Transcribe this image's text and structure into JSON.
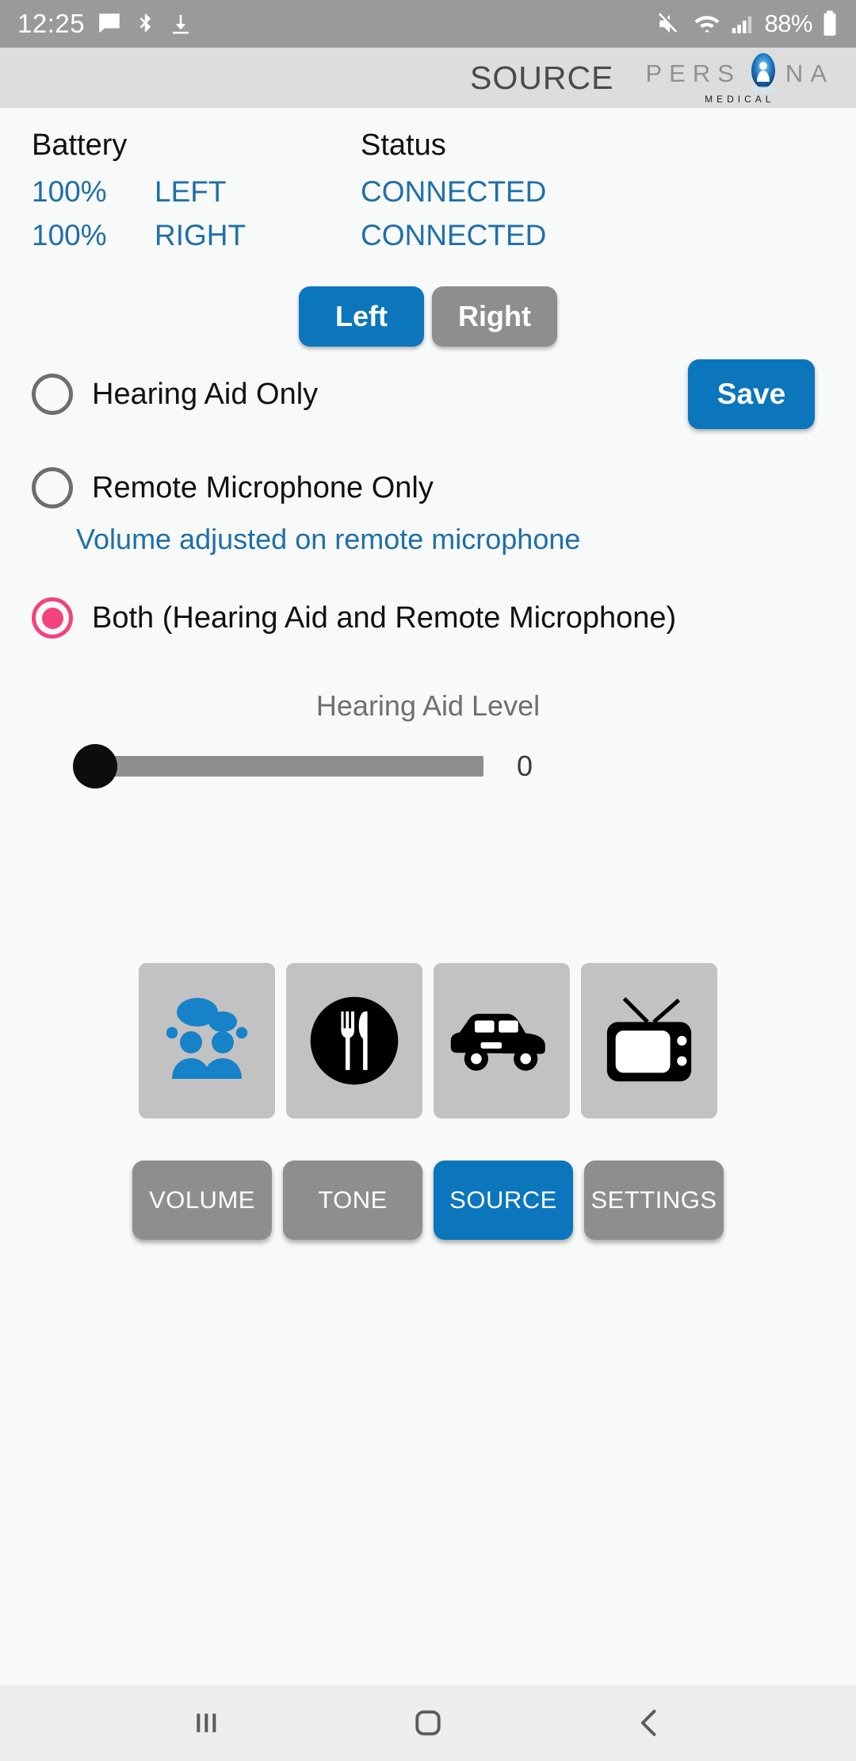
{
  "status_bar": {
    "time": "12:25",
    "battery_text": "88%",
    "icons": [
      "message-icon",
      "bluetooth-audio-icon",
      "download-icon",
      "mute-icon",
      "wifi-icon",
      "cellular-signal-icon",
      "battery-icon"
    ]
  },
  "app_bar": {
    "title": "SOURCE",
    "brand_letters": [
      "P",
      "E",
      "R",
      "S",
      "N",
      "A"
    ],
    "brand_mark": "persona-logo-icon",
    "brand_subtitle": "MEDICAL"
  },
  "info": {
    "battery_header": "Battery",
    "status_header": "Status",
    "rows": [
      {
        "percent": "100%",
        "side": "LEFT",
        "status": "CONNECTED"
      },
      {
        "percent": "100%",
        "side": "RIGHT",
        "status": "CONNECTED"
      }
    ]
  },
  "side_selector": {
    "left_label": "Left",
    "right_label": "Right",
    "selected": "Left",
    "selected_color": "#0b76bc",
    "unselected_color": "#8e8e8e"
  },
  "save": {
    "label": "Save",
    "color": "#0b76bc"
  },
  "source_options": {
    "selected_index": 2,
    "accent_color": "#f4427f",
    "items": [
      {
        "label": "Hearing Aid Only",
        "checked": false,
        "hint": ""
      },
      {
        "label": "Remote Microphone Only",
        "checked": false,
        "hint": "Volume adjusted on remote microphone"
      },
      {
        "label": "Both (Hearing Aid and Remote Microphone)",
        "checked": true,
        "hint": ""
      }
    ]
  },
  "slider": {
    "title": "Hearing Aid Level",
    "value": "0",
    "position_percent": 0,
    "min": 0,
    "max": 10
  },
  "programs": [
    {
      "name": "speech-in-noise-icon",
      "color": "#1682c8"
    },
    {
      "name": "restaurant-icon",
      "color": "#000000"
    },
    {
      "name": "car-icon",
      "color": "#000000"
    },
    {
      "name": "tv-icon",
      "color": "#000000"
    }
  ],
  "bottom_nav": {
    "active": "SOURCE",
    "items": [
      {
        "label": "VOLUME",
        "active": false
      },
      {
        "label": "TONE",
        "active": false
      },
      {
        "label": "SOURCE",
        "active": true
      },
      {
        "label": "SETTINGS",
        "active": false
      }
    ]
  },
  "system_nav": {
    "recents": "recents-icon",
    "home": "home-icon",
    "back": "back-icon"
  }
}
